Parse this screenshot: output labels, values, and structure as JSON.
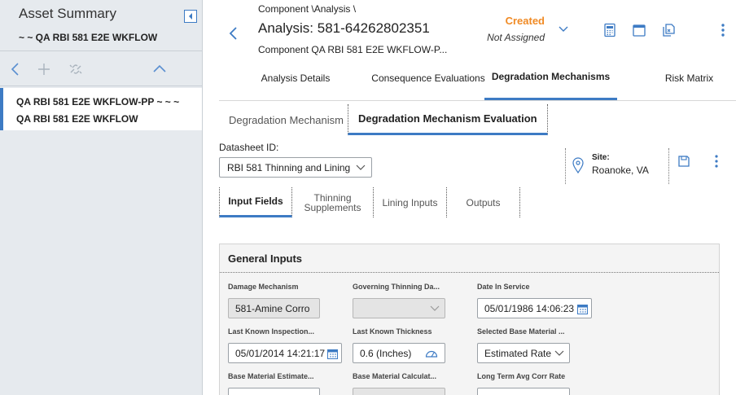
{
  "left_panel": {
    "title": "Asset Summary",
    "subtitle": "~ ~ QA RBI 581 E2E WKFLOW",
    "tree_item": {
      "line1": "QA RBI 581 E2E WKFLOW-PP ~ ~ ~",
      "line2": "QA RBI 581 E2E WKFLOW"
    }
  },
  "header": {
    "breadcrumb": "Component \\Analysis \\",
    "title": "Analysis: 581-64262802351",
    "subtitle": "Component QA RBI 581 E2E WKFLOW-P...",
    "state": "Created",
    "assignment": "Not Assigned"
  },
  "main_tabs": [
    {
      "label": "Analysis Details"
    },
    {
      "label": "Consequence Evaluations"
    },
    {
      "label": "Degradation Mechanisms"
    },
    {
      "label": "Risk Matrix"
    }
  ],
  "sub_tabs": [
    {
      "label": "Degradation Mechanism"
    },
    {
      "label": "Degradation Mechanism Evaluation"
    }
  ],
  "datasheet": {
    "label": "Datasheet ID:",
    "selected": "RBI 581 Thinning and Lining",
    "site_label": "Site:",
    "site_value": "Roanoke, VA"
  },
  "datasheet_tabs": [
    {
      "label": "Input Fields"
    },
    {
      "label": "Thinning Supplements"
    },
    {
      "label": "Lining Inputs"
    },
    {
      "label": "Outputs"
    }
  ],
  "general_inputs": {
    "title": "General Inputs",
    "fields": [
      {
        "label": "Damage Mechanism",
        "value": "581-Amine Corro"
      },
      {
        "label": "Governing Thinning Da...",
        "value": ""
      },
      {
        "label": "Date In Service",
        "value": "05/01/1986 14:06:23"
      },
      {
        "label": "Last Known Inspection...",
        "value": "05/01/2014 14:21:17"
      },
      {
        "label": "Last Known Thickness",
        "value": "0.6 (Inches)"
      },
      {
        "label": "Selected Base Material ...",
        "value": "Estimated Rate"
      },
      {
        "label": "Base Material Estimate...",
        "value": ""
      },
      {
        "label": "Base Material Calculat...",
        "value": ""
      },
      {
        "label": "Long Term Avg Corr Rate",
        "value": ""
      }
    ]
  },
  "colors": {
    "accent": "#3d7bc4",
    "state": "#f08a24",
    "left_bg": "#e6eaee"
  }
}
